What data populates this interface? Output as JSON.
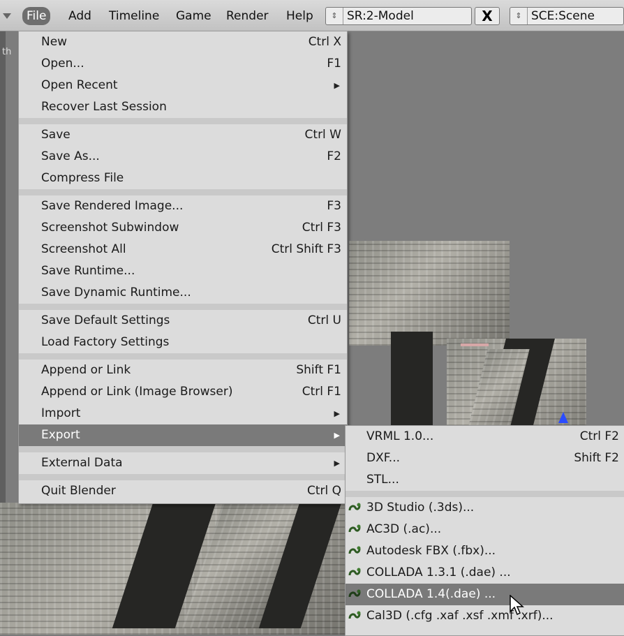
{
  "menubar": {
    "items": [
      "File",
      "Add",
      "Timeline",
      "Game",
      "Render",
      "Help"
    ],
    "screen_field": "SR:2-Model",
    "close_glyph": "X",
    "scene_field": "SCE:Scene"
  },
  "viewport": {
    "label": "th"
  },
  "file_menu": {
    "items": [
      {
        "label": "New",
        "shortcut": "Ctrl X"
      },
      {
        "label": "Open...",
        "shortcut": "F1"
      },
      {
        "label": "Open Recent",
        "shortcut": ""
      },
      {
        "label": "Recover Last Session",
        "shortcut": ""
      },
      {
        "label": "Save",
        "shortcut": "Ctrl W"
      },
      {
        "label": "Save As...",
        "shortcut": "F2"
      },
      {
        "label": "Compress File",
        "shortcut": ""
      },
      {
        "label": "Save Rendered Image...",
        "shortcut": "F3"
      },
      {
        "label": "Screenshot Subwindow",
        "shortcut": "Ctrl F3"
      },
      {
        "label": "Screenshot All",
        "shortcut": "Ctrl Shift F3"
      },
      {
        "label": "Save Runtime...",
        "shortcut": ""
      },
      {
        "label": "Save Dynamic Runtime...",
        "shortcut": ""
      },
      {
        "label": "Save Default Settings",
        "shortcut": "Ctrl U"
      },
      {
        "label": "Load Factory Settings",
        "shortcut": ""
      },
      {
        "label": "Append or Link",
        "shortcut": "Shift F1"
      },
      {
        "label": "Append or Link (Image Browser)",
        "shortcut": "Ctrl F1"
      },
      {
        "label": "Import",
        "shortcut": ""
      },
      {
        "label": "Export",
        "shortcut": ""
      },
      {
        "label": "External Data",
        "shortcut": ""
      },
      {
        "label": "Quit Blender",
        "shortcut": "Ctrl Q"
      }
    ]
  },
  "export_menu": {
    "items": [
      {
        "label": "VRML 1.0...",
        "shortcut": "Ctrl F2"
      },
      {
        "label": "DXF...",
        "shortcut": "Shift F2"
      },
      {
        "label": "STL...",
        "shortcut": ""
      },
      {
        "label": "3D Studio (.3ds)...",
        "shortcut": ""
      },
      {
        "label": "AC3D (.ac)...",
        "shortcut": ""
      },
      {
        "label": "Autodesk FBX (.fbx)...",
        "shortcut": ""
      },
      {
        "label": "COLLADA 1.3.1 (.dae) ...",
        "shortcut": ""
      },
      {
        "label": "COLLADA 1.4(.dae) ...",
        "shortcut": ""
      },
      {
        "label": "Cal3D (.cfg .xaf .xsf .xmf .xrf)...",
        "shortcut": ""
      }
    ]
  },
  "colors": {
    "highlight": "#7a7a7a",
    "menu_bg": "#dcdcdc",
    "bar_bg": "#cfcfcf"
  },
  "icons": {
    "python_script": "snake-script-icon",
    "submenu": "right-triangle-icon",
    "pointer": "mouse-pointer-icon"
  }
}
